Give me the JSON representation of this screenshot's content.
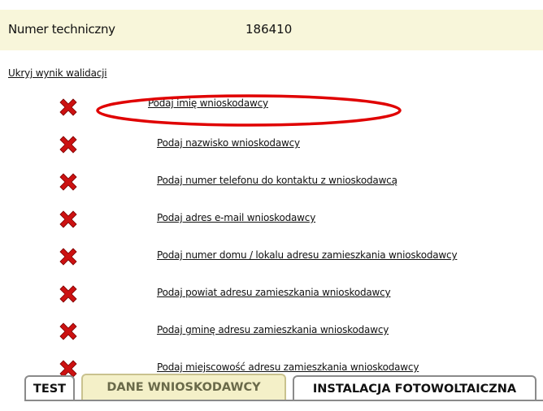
{
  "technical": {
    "label": "Numer techniczny",
    "value": "186410"
  },
  "hide_link": "Ukryj wynik walidacji",
  "validation_errors": [
    "Podaj imię wnioskodawcy",
    "Podaj nazwisko wnioskodawcy",
    "Podaj numer telefonu do kontaktu z wnioskodawcą",
    "Podaj adres e-mail wnioskodawcy",
    "Podaj numer domu / lokalu adresu zamieszkania wnioskodawcy",
    "Podaj powiat adresu zamieszkania wnioskodawcy",
    "Podaj gminę adresu zamieszkania wnioskodawcy",
    "Podaj miejscowość adresu zamieszkania wnioskodawcy"
  ],
  "error_icon": "red-x-icon",
  "tabs": [
    "TEST",
    "DANE WNIOSKODAWCY",
    "INSTALACJA FOTOWOLTAICZNA"
  ],
  "active_tab": "DANE WNIOSKODAWCY",
  "colors": {
    "error": "#cc1111",
    "highlight": "#e00000",
    "tech_bg": "#f8f6da",
    "active_tab_bg": "#f4f0c8"
  }
}
